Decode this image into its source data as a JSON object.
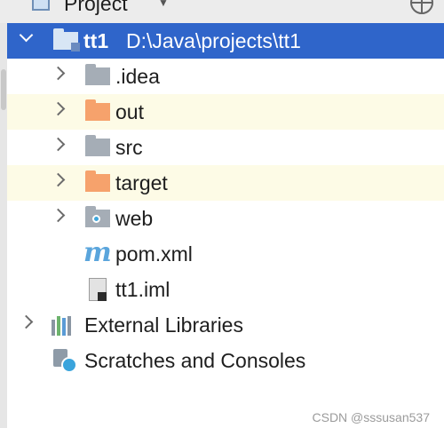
{
  "header": {
    "title": "Project",
    "dropdown_icon": "chevron-down-icon",
    "action_icon": "crosshair-icon"
  },
  "tree": {
    "root": {
      "name": "tt1",
      "path": "D:\\Java\\projects\\tt1",
      "icon": "module-folder-icon"
    },
    "children": [
      {
        "name": ".idea",
        "icon": "folder-icon"
      },
      {
        "name": "out",
        "icon": "excluded-folder-icon"
      },
      {
        "name": "src",
        "icon": "folder-icon"
      },
      {
        "name": "target",
        "icon": "excluded-folder-icon"
      },
      {
        "name": "web",
        "icon": "web-folder-icon"
      },
      {
        "name": "pom.xml",
        "icon": "maven-icon"
      },
      {
        "name": "tt1.iml",
        "icon": "iml-file-icon"
      }
    ],
    "external_libraries": {
      "name": "External Libraries",
      "icon": "libraries-icon"
    },
    "scratches": {
      "name": "Scratches and Consoles",
      "icon": "scratches-icon"
    }
  },
  "watermark": "CSDN @sssusan537",
  "colors": {
    "selection": "#2f65ca",
    "excluded_folder": "#f6a26c",
    "folder": "#a5adb6",
    "modified_row": "#fdfbe6",
    "maven_m": "#5aa5dc"
  }
}
